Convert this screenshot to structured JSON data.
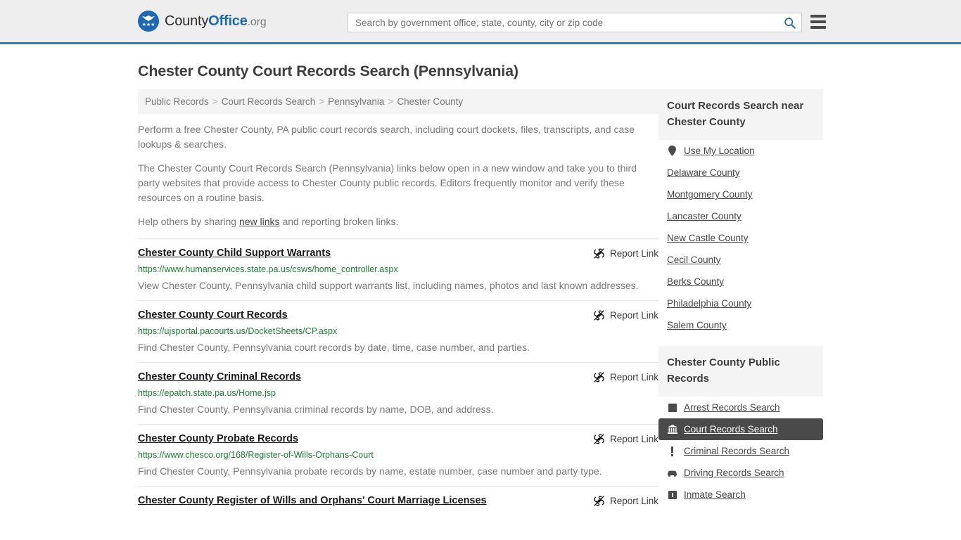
{
  "header": {
    "logo": {
      "part1": "County",
      "part2": "Office",
      "part3": ".org",
      "icon": "eagle-emblem"
    },
    "search": {
      "placeholder": "Search by government office, state, county, city or zip code",
      "value": "",
      "icon": "search-icon"
    },
    "menu_icon": "hamburger-menu-icon",
    "accent_color": "#3d77a8"
  },
  "page": {
    "title": "Chester County Court Records Search (Pennsylvania)"
  },
  "breadcrumb": {
    "separator": ">",
    "items": [
      "Public Records",
      "Court Records Search",
      "Pennsylvania",
      "Chester County"
    ]
  },
  "intro": {
    "p1": "Perform a free Chester County, PA public court records search, including court dockets, files, transcripts, and case lookups & searches.",
    "p2": "The Chester County Court Records Search (Pennsylvania) links below open in a new window and take you to third party websites that provide access to Chester County public records. Editors frequently monitor and verify these resources on a routine basis.",
    "p3_before": "Help others by sharing ",
    "p3_link": "new links",
    "p3_after": " and reporting broken links."
  },
  "results": {
    "report_label": "Report Link",
    "report_icon": "broken-link-icon",
    "items": [
      {
        "title": "Chester County Child Support Warrants",
        "url": "https://www.humanservices.state.pa.us/csws/home_controller.aspx",
        "desc": "View Chester County, Pennsylvania child support warrants list, including names, photos and last known addresses."
      },
      {
        "title": "Chester County Court Records",
        "url": "https://ujsportal.pacourts.us/DocketSheets/CP.aspx",
        "desc": "Find Chester County, Pennsylvania court records by date, time, case number, and parties."
      },
      {
        "title": "Chester County Criminal Records",
        "url": "https://epatch.state.pa.us/Home.jsp",
        "desc": "Find Chester County, Pennsylvania criminal records by name, DOB, and address."
      },
      {
        "title": "Chester County Probate Records",
        "url": "https://www.chesco.org/168/Register-of-Wills-Orphans-Court",
        "desc": "Find Chester County, Pennsylvania probate records by name, estate number, case number and party type."
      },
      {
        "title": "Chester County Register of Wills and Orphans' Court Marriage Licenses",
        "url": "",
        "desc": ""
      }
    ]
  },
  "sidebar": {
    "nearby": {
      "heading": "Court Records Search near Chester County",
      "items": [
        {
          "label": "Use My Location",
          "icon": "map-pin-icon"
        },
        {
          "label": "Delaware County",
          "icon": ""
        },
        {
          "label": "Montgomery County",
          "icon": ""
        },
        {
          "label": "Lancaster County",
          "icon": ""
        },
        {
          "label": "New Castle County",
          "icon": ""
        },
        {
          "label": "Cecil County",
          "icon": ""
        },
        {
          "label": "Berks County",
          "icon": ""
        },
        {
          "label": "Philadelphia County",
          "icon": ""
        },
        {
          "label": "Salem County",
          "icon": ""
        }
      ]
    },
    "public_records": {
      "heading": "Chester County Public Records",
      "items": [
        {
          "label": "Arrest Records Search",
          "icon": "fingerprint-icon",
          "active": false
        },
        {
          "label": "Court Records Search",
          "icon": "courthouse-icon",
          "active": true
        },
        {
          "label": "Criminal Records Search",
          "icon": "exclamation-icon",
          "active": false
        },
        {
          "label": "Driving Records Search",
          "icon": "car-icon",
          "active": false
        },
        {
          "label": "Inmate Search",
          "icon": "jail-icon",
          "active": false
        }
      ]
    }
  }
}
